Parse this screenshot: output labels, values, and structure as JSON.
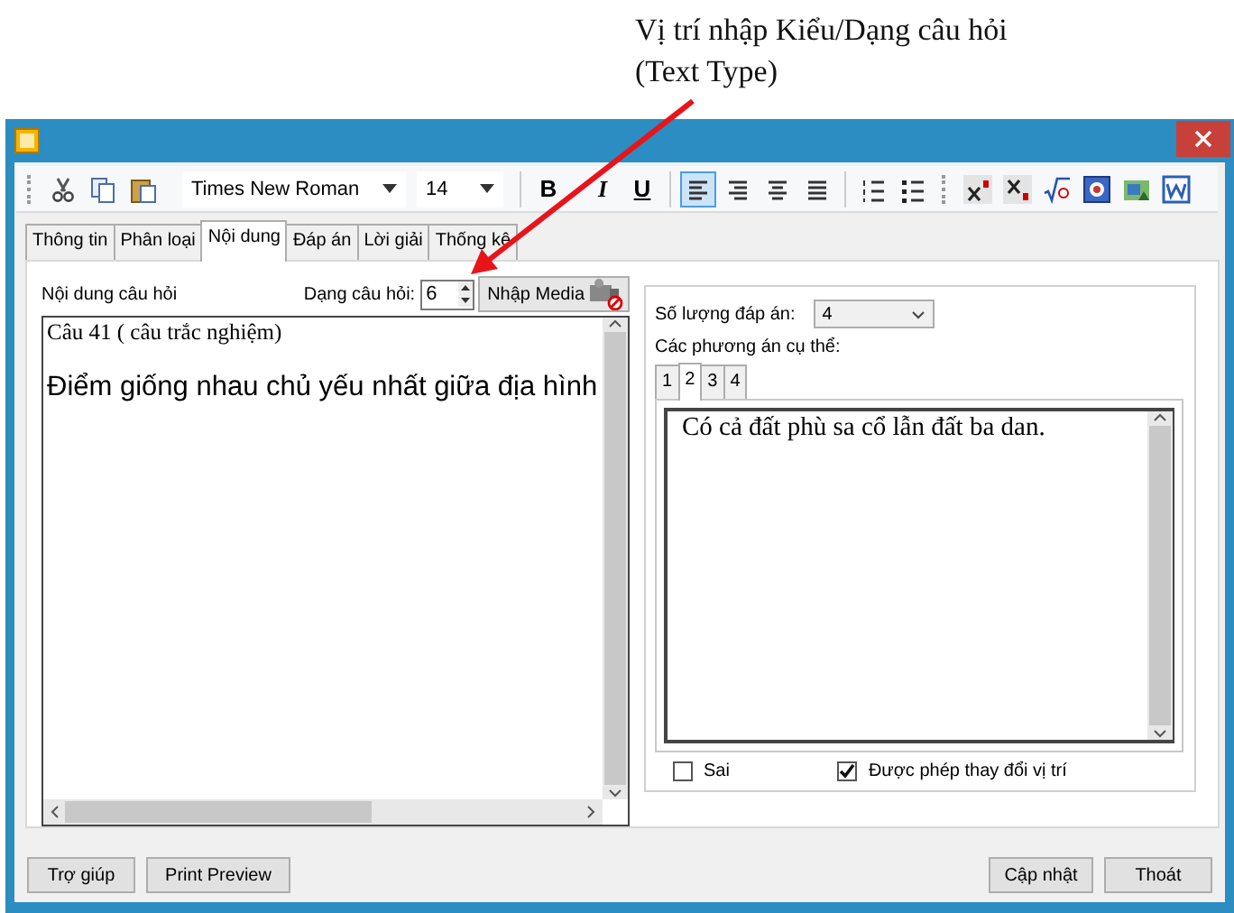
{
  "annotation": {
    "text": "Vị trí nhập Kiểu/Dạng câu hỏi (Text Type)"
  },
  "toolbar": {
    "font": "Times New Roman",
    "size": "14",
    "buttons": [
      {
        "kind": "cut",
        "pressed": false
      },
      {
        "kind": "copy",
        "pressed": false
      },
      {
        "kind": "paste",
        "pressed": false
      },
      {
        "kind": "font"
      },
      {
        "kind": "size"
      },
      {
        "kind": "bold",
        "label": "B",
        "pressed": false
      },
      {
        "kind": "italic",
        "label": "I",
        "pressed": false
      },
      {
        "kind": "underline",
        "label": "U",
        "pressed": false
      },
      {
        "kind": "align-left",
        "pressed": true
      },
      {
        "kind": "align-right",
        "pressed": false
      },
      {
        "kind": "align-center",
        "pressed": false
      },
      {
        "kind": "justify",
        "pressed": false
      },
      {
        "kind": "numbered-list",
        "pressed": false
      },
      {
        "kind": "bullet-list",
        "pressed": false
      },
      {
        "kind": "superscript",
        "pressed": false
      },
      {
        "kind": "subscript",
        "pressed": false
      },
      {
        "kind": "formula",
        "pressed": false
      },
      {
        "kind": "image",
        "pressed": false
      },
      {
        "kind": "picture",
        "pressed": false
      },
      {
        "kind": "document",
        "pressed": false
      }
    ]
  },
  "tabs": [
    {
      "label": "Thông tin",
      "selected": false
    },
    {
      "label": "Phân loại",
      "selected": false
    },
    {
      "label": "Nội dung",
      "selected": true
    },
    {
      "label": "Đáp án",
      "selected": false
    },
    {
      "label": "Lời giải",
      "selected": false
    },
    {
      "label": "Thống kê",
      "selected": false
    }
  ],
  "question": {
    "label": "Nội dung câu hỏi",
    "type_label": "Dạng câu hỏi:",
    "type_value": "6",
    "media_button": "Nhập Media",
    "lines": [
      "Câu 41 ( câu trắc nghiệm)",
      "Điểm giống nhau chủ yếu nhất giữa địa hình"
    ]
  },
  "answers": {
    "count_label": "Số lượng đáp án:",
    "count": "4",
    "options_label": "Các phương án cụ thể:",
    "tabs": [
      {
        "label": "1",
        "selected": false
      },
      {
        "label": "2",
        "selected": true
      },
      {
        "label": "3",
        "selected": false
      },
      {
        "label": "4",
        "selected": false
      }
    ],
    "text": "Có cả đất phù sa cổ lẫn đất ba dan.",
    "options": [
      {
        "label": "Sai",
        "checked": false
      },
      {
        "label": "Được phép thay đổi vị trí",
        "checked": true
      }
    ]
  },
  "footer": {
    "left": [
      "Trợ giúp",
      "Print Preview"
    ],
    "right": [
      "Cập nhật",
      "Thoát"
    ]
  }
}
